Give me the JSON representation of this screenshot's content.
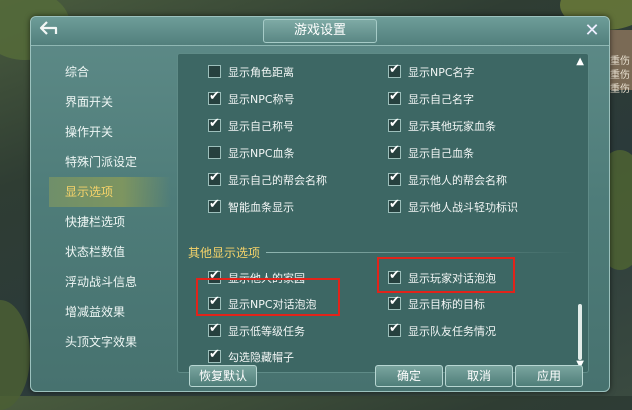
{
  "dialog": {
    "title": "游戏设置",
    "back_icon": "back-arrow-icon",
    "close_label": "✕"
  },
  "background": {
    "labels": [
      "重伤",
      "重伤",
      "重伤"
    ]
  },
  "sidebar": {
    "items": [
      {
        "label": "综合",
        "active": false
      },
      {
        "label": "界面开关",
        "active": false
      },
      {
        "label": "操作开关",
        "active": false
      },
      {
        "label": "特殊门派设定",
        "active": false
      },
      {
        "label": "显示选项",
        "active": true
      },
      {
        "label": "快捷栏选项",
        "active": false
      },
      {
        "label": "状态栏数值",
        "active": false
      },
      {
        "label": "浮动战斗信息",
        "active": false
      },
      {
        "label": "增减益效果",
        "active": false
      },
      {
        "label": "头顶文字效果",
        "active": false
      }
    ]
  },
  "options": {
    "main": [
      {
        "label": "显示角色距离",
        "checked": false
      },
      {
        "label": "显示NPC名字",
        "checked": true
      },
      {
        "label": "显示NPC称号",
        "checked": true
      },
      {
        "label": "显示自己名字",
        "checked": true
      },
      {
        "label": "显示自己称号",
        "checked": true
      },
      {
        "label": "显示其他玩家血条",
        "checked": true
      },
      {
        "label": "显示NPC血条",
        "checked": false
      },
      {
        "label": "显示自己血条",
        "checked": true
      },
      {
        "label": "显示自己的帮会名称",
        "checked": true
      },
      {
        "label": "显示他人的帮会名称",
        "checked": true
      },
      {
        "label": "智能血条显示",
        "checked": true
      },
      {
        "label": "显示他人战斗轻功标识",
        "checked": true
      }
    ],
    "other_header": "其他显示选项",
    "other": [
      {
        "label": "显示他人的家园",
        "checked": true
      },
      {
        "label": "显示玩家对话泡泡",
        "checked": true
      },
      {
        "label": "显示NPC对话泡泡",
        "checked": true
      },
      {
        "label": "显示目标的目标",
        "checked": true
      },
      {
        "label": "显示低等级任务",
        "checked": true
      },
      {
        "label": "显示队友任务情况",
        "checked": true
      },
      {
        "label": "勾选隐藏帽子",
        "checked": true
      }
    ]
  },
  "buttons": {
    "restore": "恢复默认",
    "ok": "确定",
    "cancel": "取消",
    "apply": "应用"
  },
  "scroll": {
    "up": "▲",
    "down": "▼"
  },
  "colors": {
    "accent_gold": "#f5d36a",
    "highlight_red": "#e2231a",
    "panel": "#4e7c79"
  }
}
